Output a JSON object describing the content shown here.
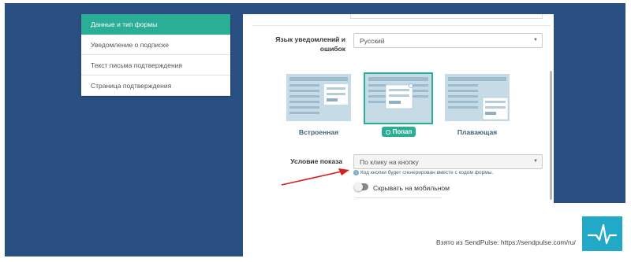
{
  "sidebar": {
    "items": [
      {
        "label": "Данные и тип формы"
      },
      {
        "label": "Уведомление о подписке"
      },
      {
        "label": "Текст письма подтверждения"
      },
      {
        "label": "Страница подтверждения"
      }
    ],
    "active_index": 0
  },
  "form": {
    "language_label": "Язык уведомлений и ошибок",
    "language_value": "Русский",
    "form_types": [
      {
        "label": "Встроенная",
        "selected": false
      },
      {
        "label": "Попап",
        "selected": true
      },
      {
        "label": "Плавающая",
        "selected": false
      }
    ],
    "display_label": "Условие показа",
    "display_value": "По клику на кнопку",
    "hint": "Код кнопки будет сгенерирован вместе с кодом формы.",
    "mobile_toggle_label": "Скрывать на мобильном",
    "mobile_toggle_on": false
  },
  "footer": {
    "credit": "Взято из SendPulse: https://sendpulse.com/ru/"
  },
  "colors": {
    "background": "#2a4f82",
    "accent": "#2aae95",
    "logo": "#21a9c7",
    "arrow": "#d42020"
  },
  "icons": [
    "chevron-down-icon",
    "info-icon",
    "radio-icon",
    "sendpulse-logo-icon"
  ]
}
